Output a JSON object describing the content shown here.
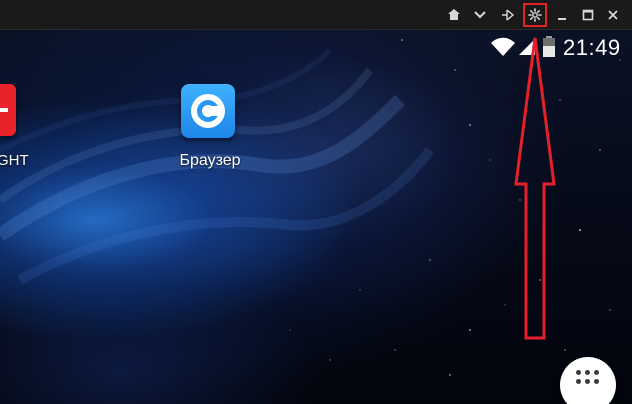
{
  "window": {
    "buttons": [
      {
        "name": "home",
        "icon": "home-icon"
      },
      {
        "name": "collapse",
        "icon": "chevron-down-icon"
      },
      {
        "name": "pin",
        "icon": "pin-icon"
      },
      {
        "name": "settings",
        "icon": "gear-icon",
        "highlighted": true
      },
      {
        "name": "minimize",
        "icon": "minimize-icon"
      },
      {
        "name": "maximize",
        "icon": "maximize-icon"
      },
      {
        "name": "close",
        "icon": "close-icon"
      }
    ]
  },
  "statusbar": {
    "time": "21:49",
    "icons": [
      "wifi-icon",
      "signal-icon",
      "battery-icon"
    ]
  },
  "desktop": {
    "apps": [
      {
        "label": "GHT",
        "icon": "red-app-icon"
      },
      {
        "label": "Браузер",
        "icon": "browser-icon"
      }
    ],
    "drawer_icon": "app-drawer-icon"
  },
  "annotation": {
    "target": "settings",
    "color": "#e4202a"
  },
  "colors": {
    "titlebar": "#1a1a1a",
    "highlight": "#e4202a",
    "browser_icon": "#2a97f2",
    "red_app": "#e8232b"
  }
}
